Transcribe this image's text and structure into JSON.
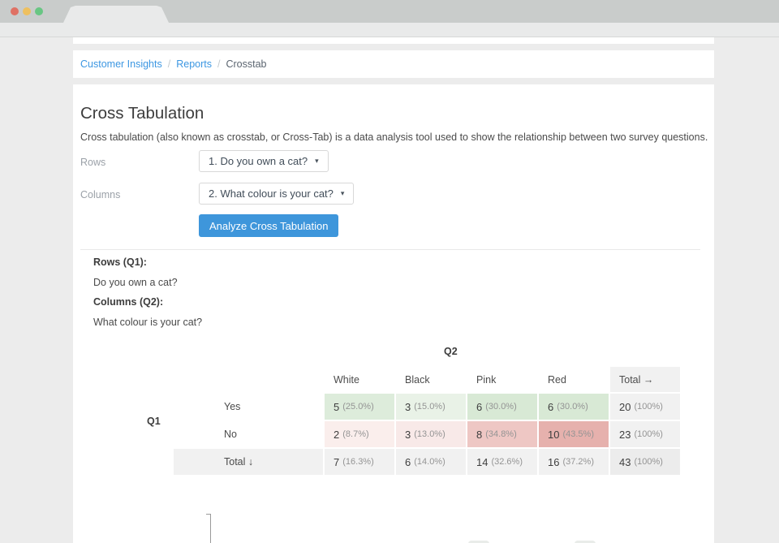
{
  "breadcrumb": {
    "items": [
      "Customer Insights",
      "Reports",
      "Crosstab"
    ],
    "separator": "/"
  },
  "header": {
    "title": "Cross Tabulation",
    "description": "Cross tabulation (also known as crosstab, or Cross-Tab) is a data analysis tool used to show the relationship between two survey questions."
  },
  "controls": {
    "rows_label": "Rows",
    "rows_value": "1. Do you own a cat?",
    "columns_label": "Columns",
    "columns_value": "2. What colour is your cat?",
    "analyze_label": "Analyze Cross Tabulation",
    "caret": "▾"
  },
  "summary": {
    "rows_heading": "Rows (Q1):",
    "rows_question": "Do you own a cat?",
    "columns_heading": "Columns (Q2):",
    "columns_question": "What colour is your cat?"
  },
  "crosstab": {
    "col_axis": "Q2",
    "row_axis": "Q1",
    "headers": [
      "White",
      "Black",
      "Pink",
      "Red",
      "Total →"
    ],
    "rows": [
      {
        "label": "Yes",
        "cells": [
          {
            "n": "5",
            "pct": "(25.0%)",
            "bg": "#ddecdb"
          },
          {
            "n": "3",
            "pct": "(15.0%)",
            "bg": "#e9f2e7"
          },
          {
            "n": "6",
            "pct": "(30.0%)",
            "bg": "#d8e9d5"
          },
          {
            "n": "6",
            "pct": "(30.0%)",
            "bg": "#d8e9d5"
          },
          {
            "n": "20",
            "pct": "(100%)",
            "bg": "#f1f1f1"
          }
        ]
      },
      {
        "label": "No",
        "cells": [
          {
            "n": "2",
            "pct": "(8.7%)",
            "bg": "#faeeec"
          },
          {
            "n": "3",
            "pct": "(13.0%)",
            "bg": "#f8e9e8"
          },
          {
            "n": "8",
            "pct": "(34.8%)",
            "bg": "#eec7c4"
          },
          {
            "n": "10",
            "pct": "(43.5%)",
            "bg": "#e6b1ad"
          },
          {
            "n": "23",
            "pct": "(100%)",
            "bg": "#f1f1f1"
          }
        ]
      },
      {
        "label": "Total ↓",
        "cells": [
          {
            "n": "7",
            "pct": "(16.3%)",
            "bg": "#f1f1f1"
          },
          {
            "n": "6",
            "pct": "(14.0%)",
            "bg": "#f1f1f1"
          },
          {
            "n": "14",
            "pct": "(32.6%)",
            "bg": "#f1f1f1"
          },
          {
            "n": "16",
            "pct": "(37.2%)",
            "bg": "#f1f1f1"
          },
          {
            "n": "43",
            "pct": "(100%)",
            "bg": "#ececec"
          }
        ]
      }
    ]
  },
  "colors": {
    "accent_blue": "#3e96db",
    "link_blue": "#3c97e2",
    "total_gray": "#f1f1f1"
  }
}
